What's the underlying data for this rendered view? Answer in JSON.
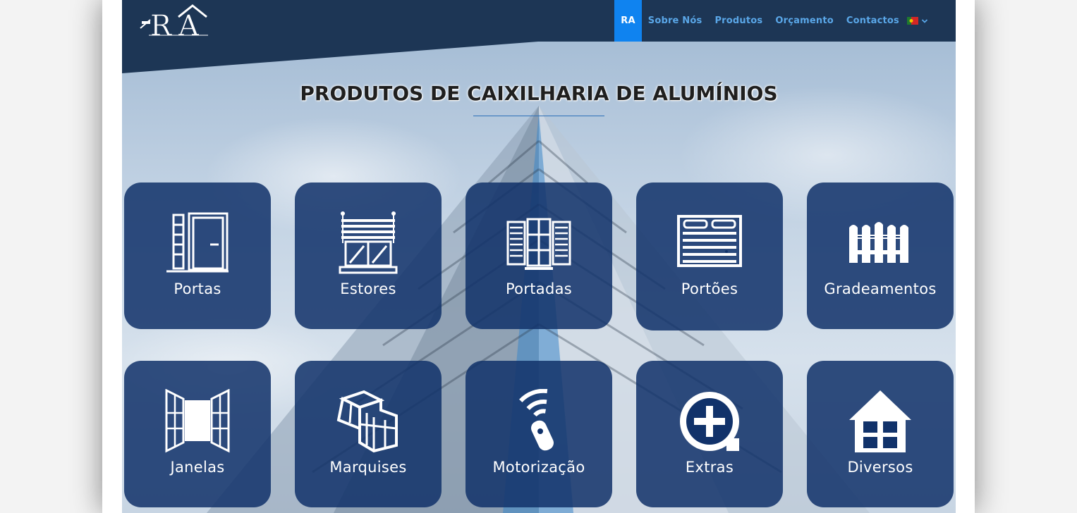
{
  "brand": {
    "logo_text": "RA"
  },
  "nav": {
    "items": [
      {
        "label": "RA",
        "active": true
      },
      {
        "label": "Sobre Nós",
        "active": false
      },
      {
        "label": "Produtos",
        "active": false
      },
      {
        "label": "Orçamento",
        "active": false
      },
      {
        "label": "Contactos",
        "active": false
      }
    ],
    "language_flag": "portugal-flag-icon"
  },
  "page": {
    "title": "PRODUTOS DE CAIXILHARIA DE ALUMÍNIOS"
  },
  "products": [
    {
      "label": "Portas",
      "icon": "door-icon"
    },
    {
      "label": "Estores",
      "icon": "roller-shutter-icon"
    },
    {
      "label": "Portadas",
      "icon": "shutters-icon"
    },
    {
      "label": "Portões",
      "icon": "garage-door-icon"
    },
    {
      "label": "Gradeamentos",
      "icon": "fence-icon"
    },
    {
      "label": "Janelas",
      "icon": "window-icon"
    },
    {
      "label": "Marquises",
      "icon": "enclosure-icon"
    },
    {
      "label": "Motorização",
      "icon": "remote-control-icon"
    },
    {
      "label": "Extras",
      "icon": "plus-circle-icon"
    },
    {
      "label": "Diversos",
      "icon": "house-icon"
    }
  ],
  "colors": {
    "header": "#1d3655",
    "accent": "#0f83f0",
    "tile": "#11326a",
    "nav_text": "#5aa7e8"
  }
}
